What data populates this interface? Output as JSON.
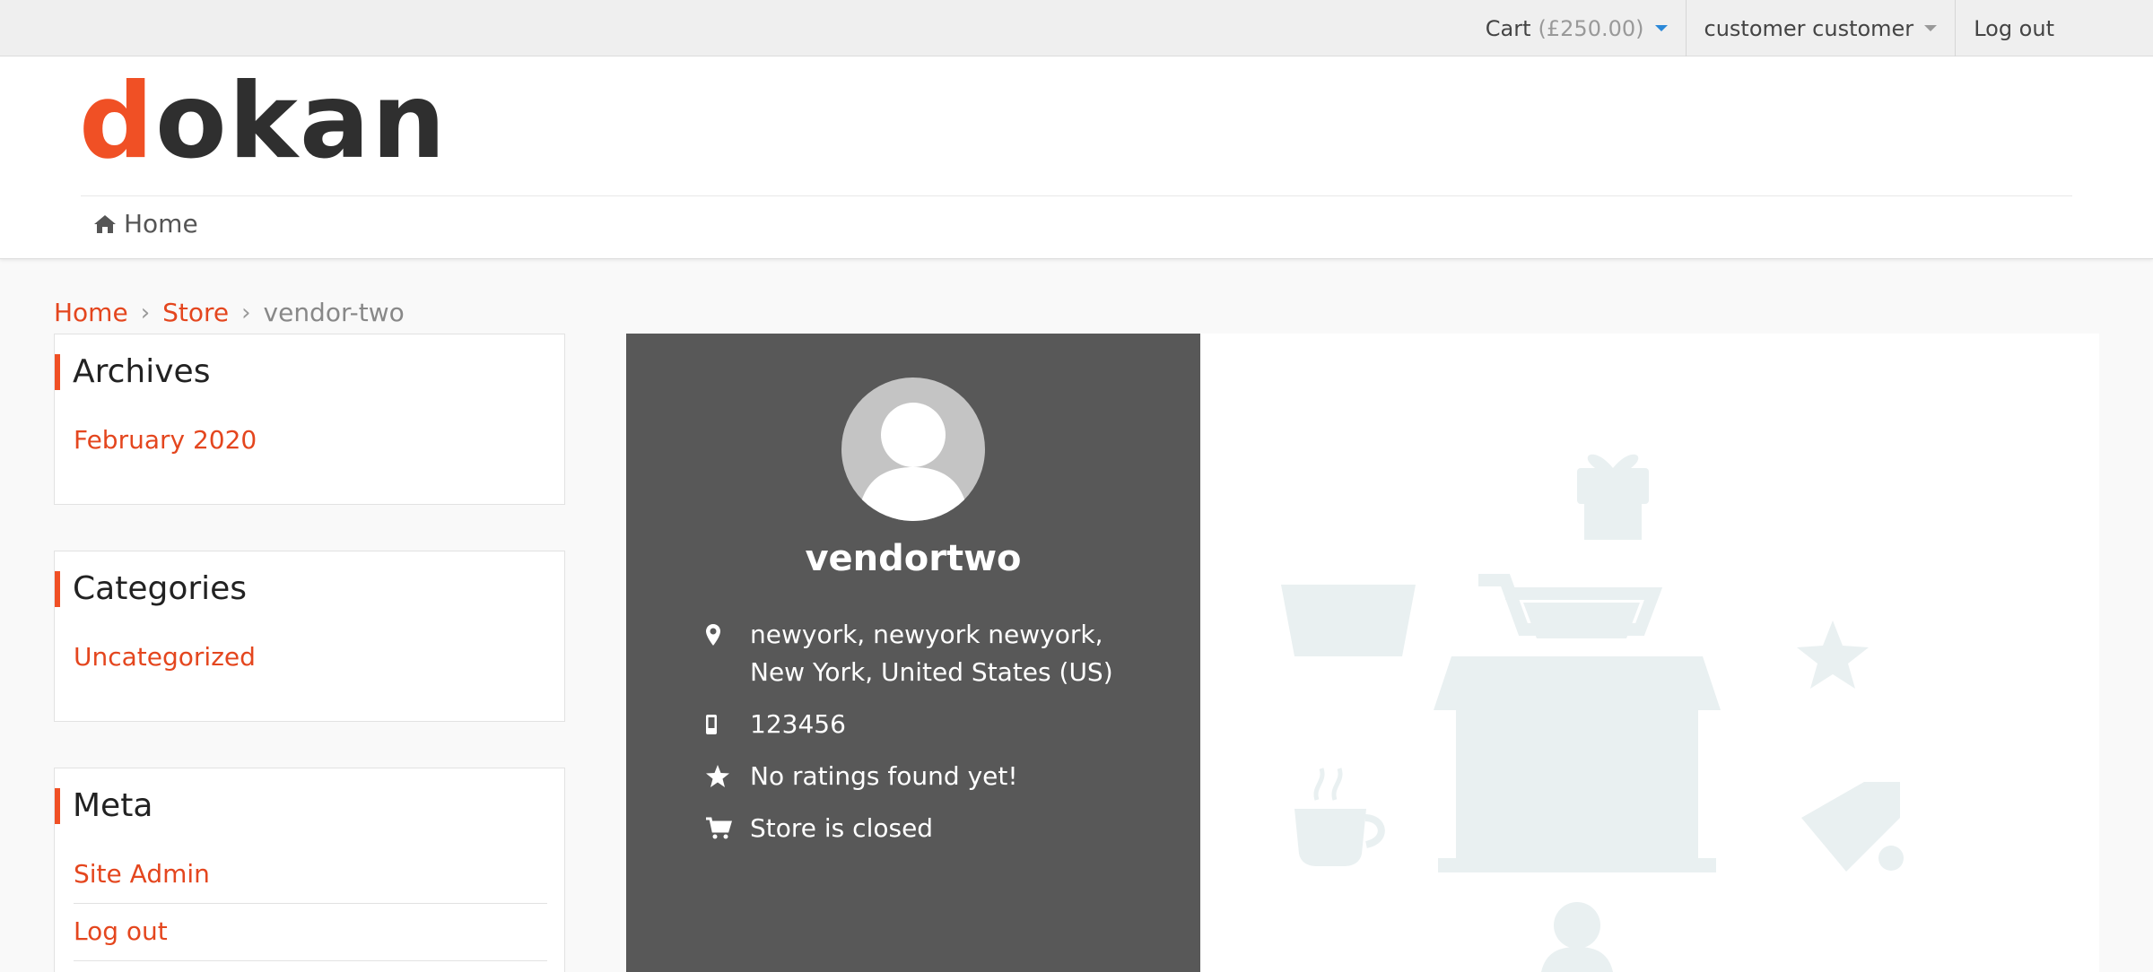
{
  "topbar": {
    "cart_label": "Cart",
    "cart_amount": "(£250.00)",
    "user_label": "customer customer",
    "logout_label": "Log out"
  },
  "header": {
    "logo_first_letter": "d",
    "logo_rest": "okan",
    "nav_home": "Home"
  },
  "breadcrumb": {
    "items": [
      "Home",
      "Store"
    ],
    "current": "vendor-two",
    "separator": "›"
  },
  "sidebar": {
    "archives": {
      "title": "Archives",
      "links": [
        "February 2020"
      ]
    },
    "categories": {
      "title": "Categories",
      "links": [
        "Uncategorized"
      ]
    },
    "meta": {
      "title": "Meta",
      "links": [
        "Site Admin",
        "Log out"
      ]
    }
  },
  "store": {
    "name": "vendortwo",
    "address": "newyork, newyork newyork, New York, United States (US)",
    "phone": "123456",
    "rating": "No ratings found yet!",
    "status": "Store is closed"
  },
  "icons": {
    "home": "home-icon",
    "location": "map-marker-icon",
    "phone": "mobile-phone-icon",
    "rating": "star-icon",
    "status": "shopping-cart-icon"
  },
  "colors": {
    "accent": "#f05025",
    "link": "#e4461e",
    "store_panel": "#585858",
    "banner_illustration": "#e9f0f1"
  }
}
